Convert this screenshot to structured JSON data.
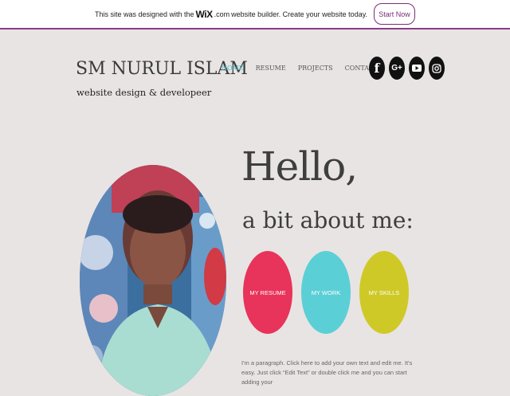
{
  "wix_banner": {
    "text_before": "This site was designed with the",
    "logo": "WiX",
    "logo_suffix": ".com",
    "text_after": "website builder. Create your website today.",
    "button_label": "Start Now"
  },
  "header": {
    "title": "SM NURUL ISLAM",
    "tagline": "website design & developeer"
  },
  "nav": {
    "items": [
      {
        "label": "HOME",
        "active": true
      },
      {
        "label": "RESUME",
        "active": false
      },
      {
        "label": "PROJECTS",
        "active": false
      },
      {
        "label": "CONTACT",
        "active": false
      }
    ]
  },
  "social": [
    {
      "icon": "facebook-icon",
      "glyph": "f"
    },
    {
      "icon": "google-plus-icon",
      "glyph": "G+"
    },
    {
      "icon": "youtube-icon",
      "glyph": ""
    },
    {
      "icon": "instagram-icon",
      "glyph": ""
    }
  ],
  "hero": {
    "hello": "Hello,",
    "subtitle": "a bit about me:"
  },
  "buttons": {
    "resume": "MY RESUME",
    "work": "MY WORK",
    "skills": "MY SKILLS"
  },
  "colors": {
    "resume": "#e8335a",
    "work": "#5bcfd6",
    "skills": "#cfc928",
    "accent": "#8a3d86",
    "nav_active": "#4fc0cc"
  },
  "paragraph": "I'm a paragraph. Click here to add your own text and edit me. It's easy. Just click “Edit Text” or double click me and you can start adding your"
}
